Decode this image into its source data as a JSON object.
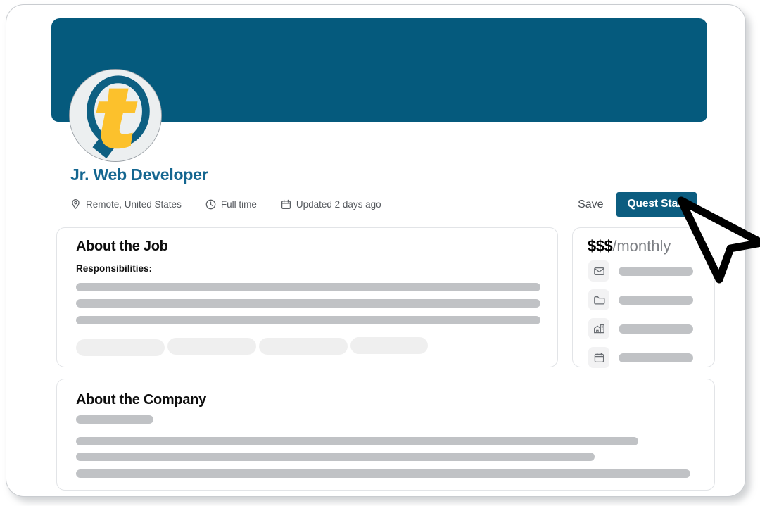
{
  "header": {
    "banner_color": "#055a7d",
    "logo_icon": "quest-magnifier-logo",
    "job_title": "Jr. Web Developer"
  },
  "meta": [
    {
      "icon": "location-pin-icon",
      "label": "Remote, United States"
    },
    {
      "icon": "clock-icon",
      "label": "Full time"
    },
    {
      "icon": "calendar-icon",
      "label": "Updated 2 days ago"
    }
  ],
  "actions": {
    "save_label": "Save",
    "quest_start_label": "Quest Start",
    "quest_start_color": "#0c5d80"
  },
  "about_job": {
    "title": "About the Job",
    "subtitle": "Responsibilities:"
  },
  "salary": {
    "amount": "$$$",
    "period": "/monthly",
    "details": [
      {
        "icon": "mail-icon"
      },
      {
        "icon": "folder-icon"
      },
      {
        "icon": "company-building-icon"
      },
      {
        "icon": "calendar-icon"
      }
    ]
  },
  "about_company": {
    "title": "About the Company"
  },
  "cursor": {
    "icon": "mouse-pointer-arrow"
  }
}
